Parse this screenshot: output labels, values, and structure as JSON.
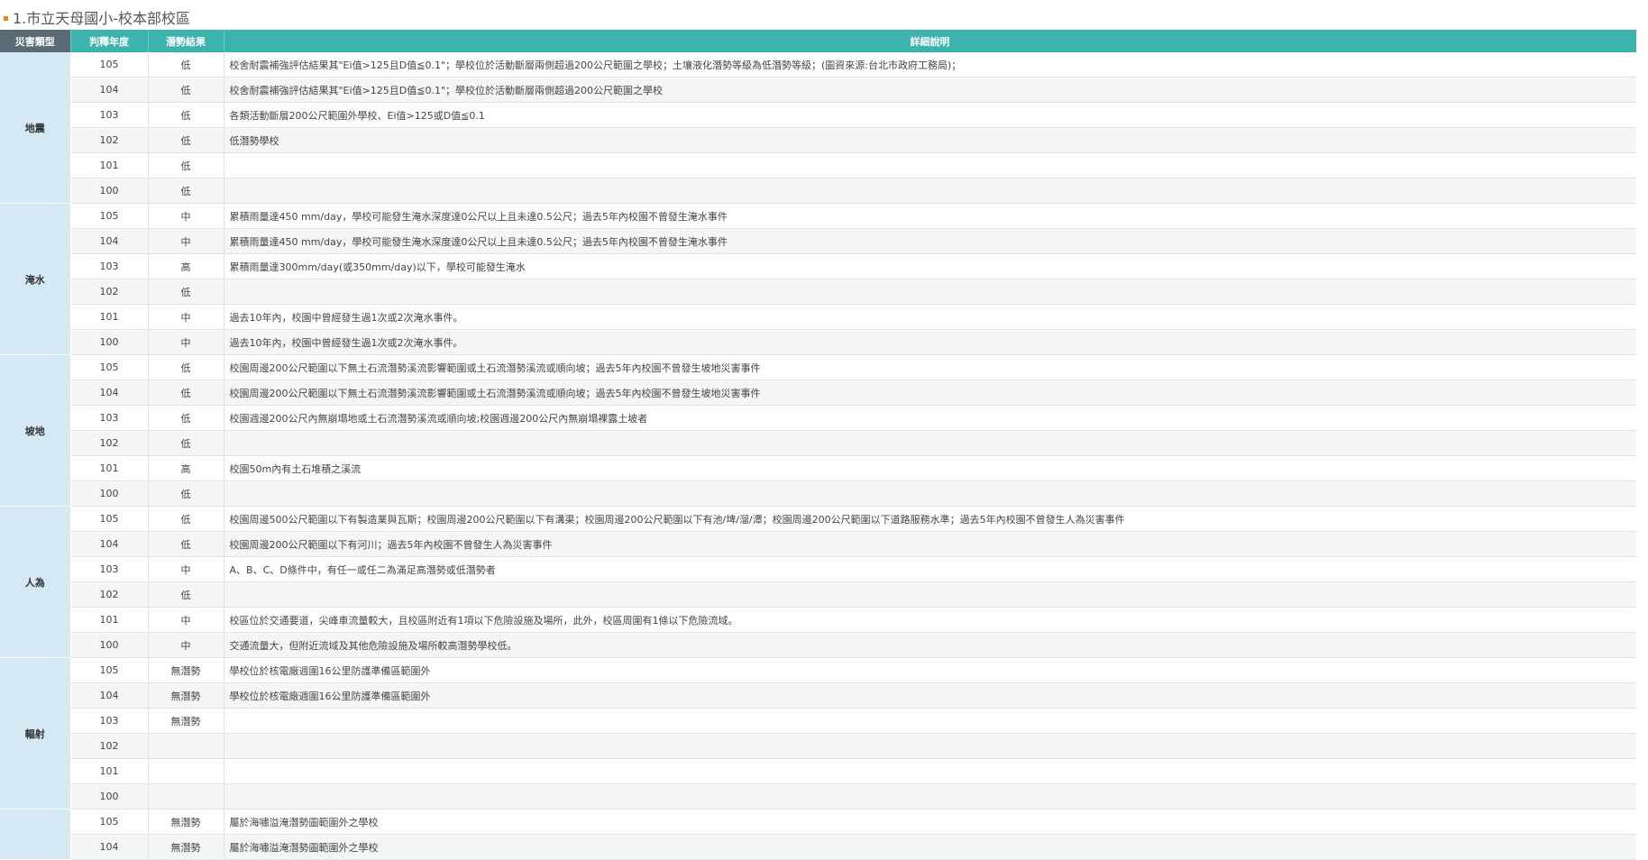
{
  "title": "1.市立天母國小-校本部校區",
  "headers": [
    "災害類型",
    "判釋年度",
    "潛勢結果",
    "詳細說明"
  ],
  "groups": [
    {
      "type": "地震",
      "rows": [
        {
          "year": "105",
          "result": "低",
          "detail": "校舍耐震補強評估結果其\"Ei值>125且D值≦0.1\"；學校位於活動斷層兩側超過200公尺範圍之學校；土壤液化潛勢等級為低潛勢等級；(圖資來源:台北市政府工務局)；"
        },
        {
          "year": "104",
          "result": "低",
          "detail": "校舍耐震補強評估結果其\"Ei值>125且D值≦0.1\"；學校位於活動斷層兩側超過200公尺範圍之學校"
        },
        {
          "year": "103",
          "result": "低",
          "detail": "各類活動斷層200公尺範圍外學校、Ei值>125或D值≦0.1"
        },
        {
          "year": "102",
          "result": "低",
          "detail": "低潛勢學校"
        },
        {
          "year": "101",
          "result": "低",
          "detail": ""
        },
        {
          "year": "100",
          "result": "低",
          "detail": ""
        }
      ]
    },
    {
      "type": "淹水",
      "rows": [
        {
          "year": "105",
          "result": "中",
          "detail": "累積雨量達450 mm/day，學校可能發生淹水深度達0公尺以上且未達0.5公尺；過去5年內校園不曾發生淹水事件"
        },
        {
          "year": "104",
          "result": "中",
          "detail": "累積雨量達450 mm/day，學校可能發生淹水深度達0公尺以上且未達0.5公尺；過去5年內校園不曾發生淹水事件"
        },
        {
          "year": "103",
          "result": "高",
          "detail": "累積雨量達300mm/day(或350mm/day)以下，學校可能發生淹水"
        },
        {
          "year": "102",
          "result": "低",
          "detail": ""
        },
        {
          "year": "101",
          "result": "中",
          "detail": "過去10年內，校園中曾經發生過1次或2次淹水事件。"
        },
        {
          "year": "100",
          "result": "中",
          "detail": "過去10年內，校園中曾經發生過1次或2次淹水事件。"
        }
      ]
    },
    {
      "type": "坡地",
      "rows": [
        {
          "year": "105",
          "result": "低",
          "detail": "校園周邊200公尺範圍以下無土石流潛勢溪流影響範圍或土石流潛勢溪流或順向坡；過去5年內校園不曾發生坡地災害事件"
        },
        {
          "year": "104",
          "result": "低",
          "detail": "校園周邊200公尺範圍以下無土石流潛勢溪流影響範圍或土石流潛勢溪流或順向坡；過去5年內校園不曾發生坡地災害事件"
        },
        {
          "year": "103",
          "result": "低",
          "detail": "校園週邊200公尺內無崩塌地或土石流潛勢溪流或順向坡;校園週邊200公尺內無崩塌裸露土坡者"
        },
        {
          "year": "102",
          "result": "低",
          "detail": ""
        },
        {
          "year": "101",
          "result": "高",
          "detail": "校園50m內有土石堆積之溪流"
        },
        {
          "year": "100",
          "result": "低",
          "detail": ""
        }
      ]
    },
    {
      "type": "人為",
      "rows": [
        {
          "year": "105",
          "result": "低",
          "detail": "校園周邊500公尺範圍以下有製造業與瓦斯；校園周邊200公尺範圍以下有溝渠；校園周邊200公尺範圍以下有池/埤/溜/潭；校園周邊200公尺範圍以下道路服務水準；過去5年內校園不曾發生人為災害事件"
        },
        {
          "year": "104",
          "result": "低",
          "detail": "校園周邊200公尺範圍以下有河川；過去5年內校園不曾發生人為災害事件"
        },
        {
          "year": "103",
          "result": "中",
          "detail": "A、B、C、D條件中，有任一或任二為滿足高潛勢或低潛勢者"
        },
        {
          "year": "102",
          "result": "低",
          "detail": ""
        },
        {
          "year": "101",
          "result": "中",
          "detail": "校區位於交通要道，尖峰車流量較大，且校區附近有1項以下危險設施及場所，此外，校區周圍有1條以下危險流域。"
        },
        {
          "year": "100",
          "result": "中",
          "detail": "交通流量大，但附近流域及其他危險設施及場所較高潛勢學校低。"
        }
      ]
    },
    {
      "type": "輻射",
      "rows": [
        {
          "year": "105",
          "result": "無潛勢",
          "detail": "學校位於核電廠週圍16公里防護準備區範圍外"
        },
        {
          "year": "104",
          "result": "無潛勢",
          "detail": "學校位於核電廠週圍16公里防護準備區範圍外"
        },
        {
          "year": "103",
          "result": "無潛勢",
          "detail": ""
        },
        {
          "year": "102",
          "result": "",
          "detail": ""
        },
        {
          "year": "101",
          "result": "",
          "detail": ""
        },
        {
          "year": "100",
          "result": "",
          "detail": ""
        }
      ]
    },
    {
      "type": "",
      "rows": [
        {
          "year": "105",
          "result": "無潛勢",
          "detail": "屬於海嘯溢淹潛勢圖範圍外之學校"
        },
        {
          "year": "104",
          "result": "無潛勢",
          "detail": "屬於海嘯溢淹潛勢圖範圍外之學校"
        }
      ]
    }
  ]
}
